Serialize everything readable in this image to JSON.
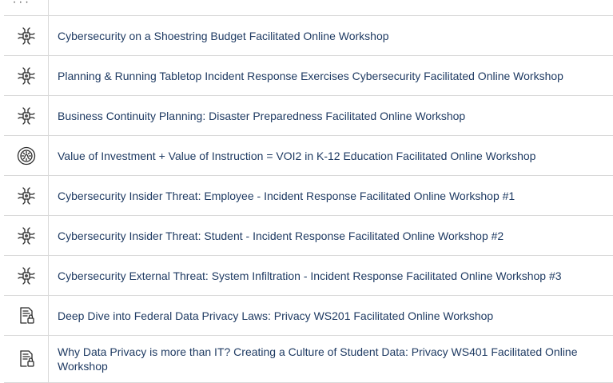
{
  "workshops": [
    {
      "title": "Cybersecurity on a Shoestring Budget Facilitated Online Workshop",
      "icon": "circuit-chip-icon"
    },
    {
      "title": "Planning & Running Tabletop Incident Response Exercises Cybersecurity Facilitated Online Workshop",
      "icon": "circuit-chip-icon"
    },
    {
      "title": "Business Continuity Planning: Disaster Preparedness Facilitated Online Workshop",
      "icon": "circuit-chip-icon"
    },
    {
      "title": "Value of Investment + Value of Instruction = VOI2 in K-12 Education Facilitated Online Workshop",
      "icon": "gear-badge-icon"
    },
    {
      "title": "Cybersecurity Insider Threat: Employee - Incident Response Facilitated Online Workshop #1",
      "icon": "circuit-chip-icon"
    },
    {
      "title": "Cybersecurity Insider Threat: Student - Incident Response Facilitated Online Workshop #2",
      "icon": "circuit-chip-icon"
    },
    {
      "title": "Cybersecurity External Threat: System Infiltration - Incident Response Facilitated Online Workshop #3",
      "icon": "circuit-chip-icon"
    },
    {
      "title": "Deep Dive into Federal Data Privacy Laws: Privacy WS201 Facilitated Online Workshop",
      "icon": "document-lock-icon"
    },
    {
      "title": "Why Data Privacy is more than IT? Creating a Culture of Student Data: Privacy WS401 Facilitated Online Workshop",
      "icon": "document-lock-icon"
    }
  ]
}
